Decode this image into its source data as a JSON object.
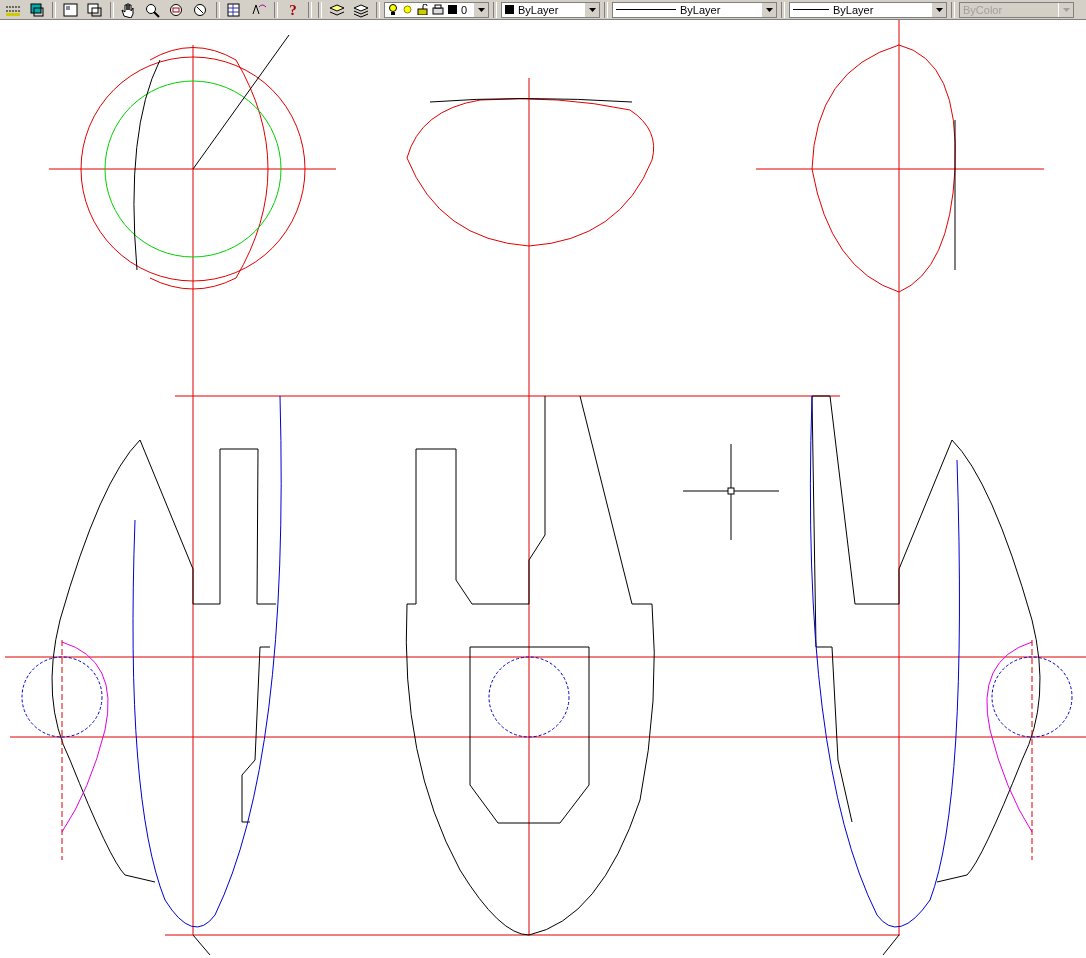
{
  "toolbar": {
    "dropdowns": [
      {
        "kind": "layer",
        "value": "0",
        "disabled": false
      },
      {
        "kind": "color",
        "value": "ByLayer",
        "disabled": false
      },
      {
        "kind": "linetype",
        "value": "ByLayer",
        "disabled": false
      },
      {
        "kind": "lineweight",
        "value": "ByLayer",
        "disabled": false
      },
      {
        "kind": "plotstyle",
        "value": "ByColor",
        "disabled": true
      }
    ]
  },
  "help_icon": "?"
}
